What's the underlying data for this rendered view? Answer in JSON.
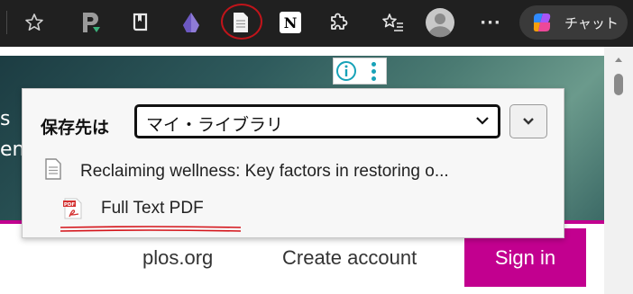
{
  "toolbar": {
    "icons": {
      "favorite": "star-outline-icon",
      "ext_p": "p-extension-icon",
      "ext_book": "book-icon",
      "ext_crystal": "crystal-icon",
      "ext_zotero": "zotero-save-page-icon",
      "ext_notion": "notion-icon",
      "extensions": "puzzle-icon",
      "favorites_list": "favorites-list-icon",
      "profile": "profile-avatar-icon",
      "more": "more-icon"
    },
    "notion_letter": "N",
    "more_label": "···",
    "copilot_label": "チャット",
    "annotation_color": "#c0141a"
  },
  "page": {
    "hero_line1": "s",
    "hero_line2": "en",
    "nav_plos": "plos.org",
    "nav_create_account": "Create account",
    "sign_in": "Sign in",
    "accent_color": "#c2008f"
  },
  "popup": {
    "save_label": "保存先は",
    "collection_value": "マイ・ライブラリ",
    "item_title": "Reclaiming wellness: Key factors in restoring o...",
    "attachment_label": "Full Text PDF",
    "pdf_badge": "PDF"
  }
}
